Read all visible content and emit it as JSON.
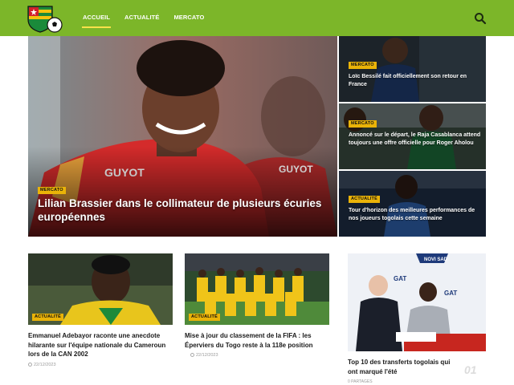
{
  "site": {
    "logo_icon": "togo-flag-football-logo",
    "accent": "#7cb629"
  },
  "nav": {
    "items": [
      {
        "label": "ACCUEIL",
        "active": true
      },
      {
        "label": "ACTUALITÉ",
        "active": false
      },
      {
        "label": "MERCATO",
        "active": false
      }
    ],
    "search_icon": "search-icon"
  },
  "hero": {
    "badge": "MERCATO",
    "title": "Lilian Brassier dans le collimateur de plusieurs écuries européennes"
  },
  "side_stories": [
    {
      "badge": "MERCATO",
      "title": "Loïc Bessilé fait officiellement son retour en France"
    },
    {
      "badge": "MERCATO",
      "title": "Annoncé sur le départ, le Raja Casablanca attend toujours une offre officielle pour Roger Aholou"
    },
    {
      "badge": "ACTUALITÉ",
      "title": "Tour d'horizon des meilleures performances de nos joueurs togolais cette semaine"
    }
  ],
  "cards": [
    {
      "badge": "ACTUALITÉ",
      "title": "Emmanuel Adebayor raconte une anecdote hilarante sur l'équipe nationale du Cameroun lors de la CAN 2002",
      "date": "22/12/2023"
    },
    {
      "badge": "ACTUALITÉ",
      "title": "Mise à jour du classement de la FIFA : les Éperviers du Togo reste à la 118e position",
      "date": "22/12/2023"
    }
  ],
  "popular": {
    "title": "Top 10 des transferts togolais qui ont marqué l'été",
    "rank": "01",
    "meta": "0 PARTAGES"
  },
  "colors": {
    "badge": "#eab308",
    "header": "#7cb629"
  }
}
